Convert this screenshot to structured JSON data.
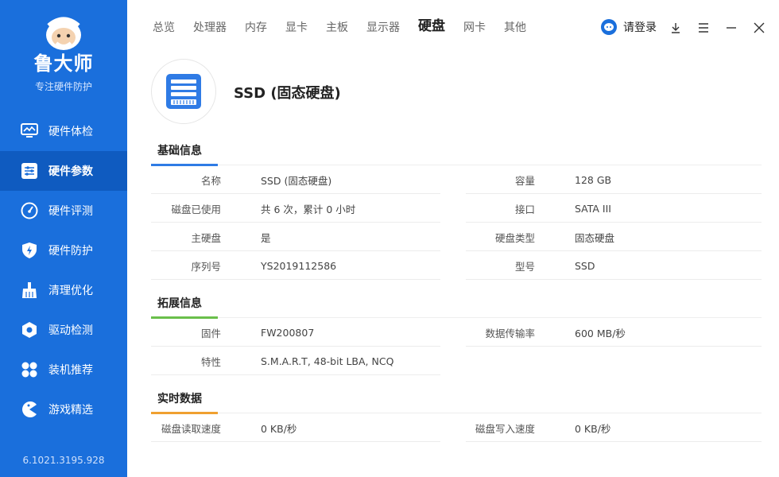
{
  "app": {
    "brand": "鲁大师",
    "tagline": "专注硬件防护",
    "version": "6.1021.3195.928"
  },
  "sidebar": {
    "items": [
      {
        "label": "硬件体检",
        "icon": "monitor-icon",
        "active": false
      },
      {
        "label": "硬件参数",
        "icon": "sliders-icon",
        "active": true
      },
      {
        "label": "硬件评测",
        "icon": "gauge-icon",
        "active": false
      },
      {
        "label": "硬件防护",
        "icon": "shield-bolt-icon",
        "active": false
      },
      {
        "label": "清理优化",
        "icon": "broom-icon",
        "active": false
      },
      {
        "label": "驱动检测",
        "icon": "gear-hex-icon",
        "active": false
      },
      {
        "label": "装机推荐",
        "icon": "puzzle-icon",
        "active": false
      },
      {
        "label": "游戏精选",
        "icon": "pacman-icon",
        "active": false
      }
    ]
  },
  "tabs": [
    {
      "label": "总览",
      "active": false
    },
    {
      "label": "处理器",
      "active": false
    },
    {
      "label": "内存",
      "active": false
    },
    {
      "label": "显卡",
      "active": false
    },
    {
      "label": "主板",
      "active": false
    },
    {
      "label": "显示器",
      "active": false
    },
    {
      "label": "硬盘",
      "active": true
    },
    {
      "label": "网卡",
      "active": false
    },
    {
      "label": "其他",
      "active": false
    }
  ],
  "topbar": {
    "login_label": "请登录"
  },
  "device": {
    "title": "SSD (固态硬盘)",
    "icon": "disk-icon"
  },
  "sections": {
    "basic": {
      "title": "基础信息",
      "rows": [
        {
          "k1": "名称",
          "v1": "SSD (固态硬盘)",
          "k2": "容量",
          "v2": "128 GB"
        },
        {
          "k1": "磁盘已使用",
          "v1": "共 6 次，累计 0 小时",
          "k2": "接口",
          "v2": "SATA III"
        },
        {
          "k1": "主硬盘",
          "v1": "是",
          "k2": "硬盘类型",
          "v2": "固态硬盘"
        },
        {
          "k1": "序列号",
          "v1": "YS2019112586",
          "k2": "型号",
          "v2": "SSD"
        }
      ]
    },
    "extended": {
      "title": "拓展信息",
      "rows": [
        {
          "k1": "固件",
          "v1": "FW200807",
          "k2": "数据传输率",
          "v2": "600 MB/秒"
        },
        {
          "k1": "特性",
          "v1": "S.M.A.R.T, 48-bit LBA, NCQ",
          "k2": "",
          "v2": ""
        }
      ]
    },
    "realtime": {
      "title": "实时数据",
      "rows": [
        {
          "k1": "磁盘读取速度",
          "v1": "0 KB/秒",
          "k2": "磁盘写入速度",
          "v2": "0 KB/秒"
        }
      ]
    }
  },
  "colors": {
    "sidebar": "#1a6fdc",
    "sidebar_active": "#0f5bc0",
    "basic_accent": "#2f7be5",
    "extended_accent": "#6abf4b",
    "realtime_accent": "#f0a030"
  }
}
